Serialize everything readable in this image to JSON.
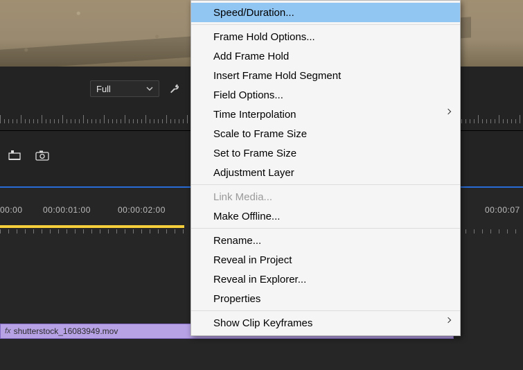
{
  "monitor": {
    "quality_label": "Full"
  },
  "timeline": {
    "timecodes": [
      "00:00",
      "00:00:01:00",
      "00:00:02:00",
      "00:00:07"
    ],
    "clip": {
      "fx_badge": "fx",
      "name": "shutterstock_16083949.mov"
    }
  },
  "context_menu": {
    "items": [
      {
        "label": "Speed/Duration...",
        "highlight": true
      },
      {
        "sep": true
      },
      {
        "label": "Frame Hold Options..."
      },
      {
        "label": "Add Frame Hold"
      },
      {
        "label": "Insert Frame Hold Segment"
      },
      {
        "label": "Field Options..."
      },
      {
        "label": "Time Interpolation",
        "submenu": true
      },
      {
        "label": "Scale to Frame Size"
      },
      {
        "label": "Set to Frame Size"
      },
      {
        "label": "Adjustment Layer"
      },
      {
        "sep": true
      },
      {
        "label": "Link Media...",
        "disabled": true
      },
      {
        "label": "Make Offline..."
      },
      {
        "sep": true
      },
      {
        "label": "Rename..."
      },
      {
        "label": "Reveal in Project"
      },
      {
        "label": "Reveal in Explorer..."
      },
      {
        "label": "Properties"
      },
      {
        "sep": true
      },
      {
        "label": "Show Clip Keyframes",
        "submenu": true
      }
    ]
  }
}
